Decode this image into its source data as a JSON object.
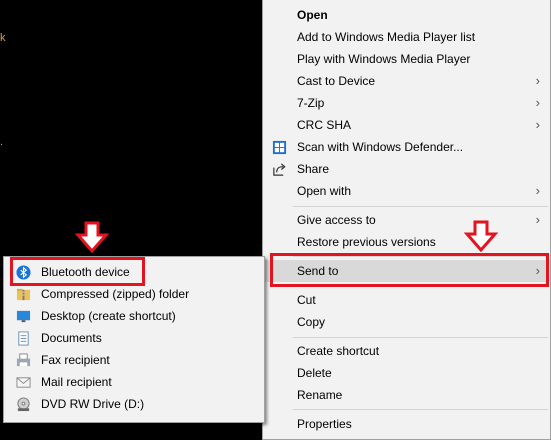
{
  "desktop": {
    "glyph_1": "k",
    "glyph_2": "."
  },
  "context_menu": {
    "items": [
      {
        "label": "Open",
        "bold": true
      },
      {
        "label": "Add to Windows Media Player list"
      },
      {
        "label": "Play with Windows Media Player"
      },
      {
        "label": "Cast to Device",
        "submenu": true
      },
      {
        "label": "7-Zip",
        "submenu": true
      },
      {
        "label": "CRC SHA",
        "submenu": true
      },
      {
        "label": "Scan with Windows Defender...",
        "icon": "windows-defender-icon"
      },
      {
        "label": "Share",
        "icon": "share-icon"
      },
      {
        "label": "Open with",
        "submenu": true
      },
      {
        "label": "Give access to",
        "submenu": true
      },
      {
        "label": "Restore previous versions"
      },
      {
        "label": "Send to",
        "submenu": true,
        "highlighted": true
      },
      {
        "label": "Cut"
      },
      {
        "label": "Copy"
      },
      {
        "label": "Create shortcut"
      },
      {
        "label": "Delete"
      },
      {
        "label": "Rename"
      },
      {
        "label": "Properties"
      }
    ],
    "chevron": "›"
  },
  "send_to_menu": {
    "items": [
      {
        "label": "Bluetooth device",
        "icon": "bluetooth-icon",
        "highlighted": true
      },
      {
        "label": "Compressed (zipped) folder",
        "icon": "zip-folder-icon"
      },
      {
        "label": "Desktop (create shortcut)",
        "icon": "desktop-icon"
      },
      {
        "label": "Documents",
        "icon": "documents-icon"
      },
      {
        "label": "Fax recipient",
        "icon": "fax-icon"
      },
      {
        "label": "Mail recipient",
        "icon": "mail-icon"
      },
      {
        "label": "DVD RW Drive (D:)",
        "icon": "dvd-drive-icon"
      }
    ]
  },
  "colors": {
    "annotation_red": "#e3141f",
    "menu_bg": "#f2f2f2",
    "highlight_bg": "#d9d9d9"
  }
}
